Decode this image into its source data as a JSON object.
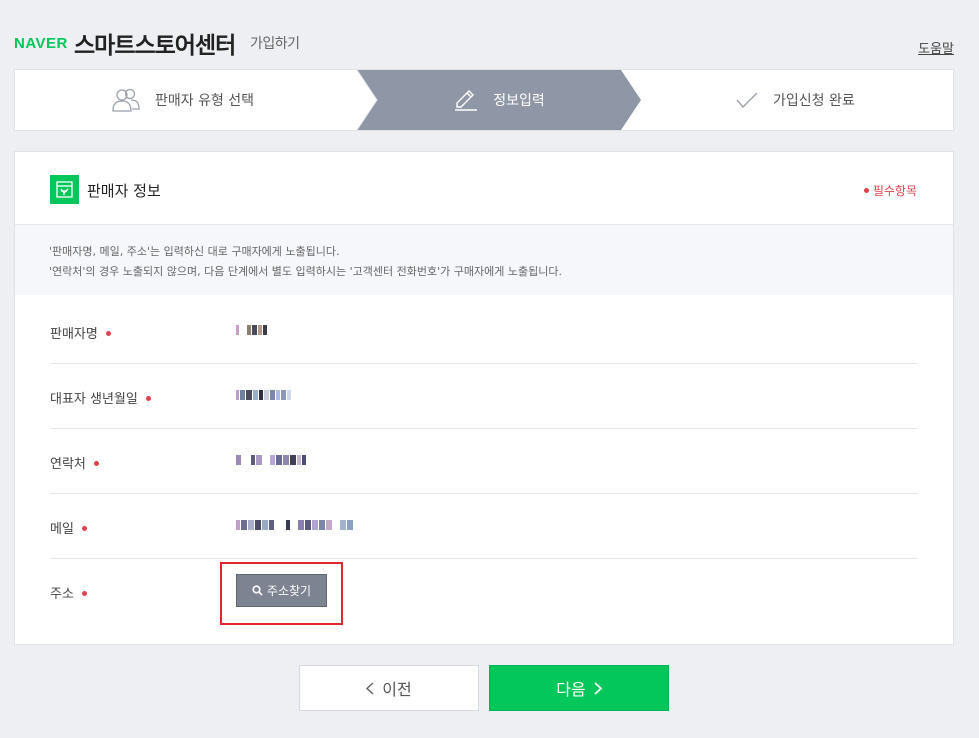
{
  "header": {
    "brand": "NAVER",
    "title": "스마트스토어센터",
    "subtitle": "가입하기",
    "help_link": "도움말"
  },
  "steps": [
    {
      "label": "판매자 유형 선택",
      "icon": "users-icon",
      "active": false
    },
    {
      "label": "정보입력",
      "icon": "pencil-icon",
      "active": true
    },
    {
      "label": "가입신청 완료",
      "icon": "check-icon",
      "active": false
    }
  ],
  "colors": {
    "brand_green": "#03c75a",
    "active_step": "#8f96a6",
    "required_red": "#e0424d",
    "highlight_red": "#e0262e"
  },
  "panel": {
    "title": "판매자 정보",
    "required_note": "필수항목",
    "notice_lines": [
      "'판매자명, 메일, 주소'는 입력하신 대로 구매자에게 노출됩니다.",
      "'연락처'의 경우 노출되지 않으며, 다음 단계에서 별도 입력하시는 '고객센터 전화번호'가 구매자에게 노출됩니다."
    ],
    "fields": [
      {
        "label": "판매자명",
        "value": "(redacted)"
      },
      {
        "label": "대표자 생년월일",
        "value": "(redacted)"
      },
      {
        "label": "연락처",
        "value": "(redacted)"
      },
      {
        "label": "메일",
        "value": "(redacted)"
      },
      {
        "label": "주소",
        "button": "주소찾기"
      }
    ]
  },
  "footer": {
    "prev_label": "이전",
    "next_label": "다음"
  }
}
